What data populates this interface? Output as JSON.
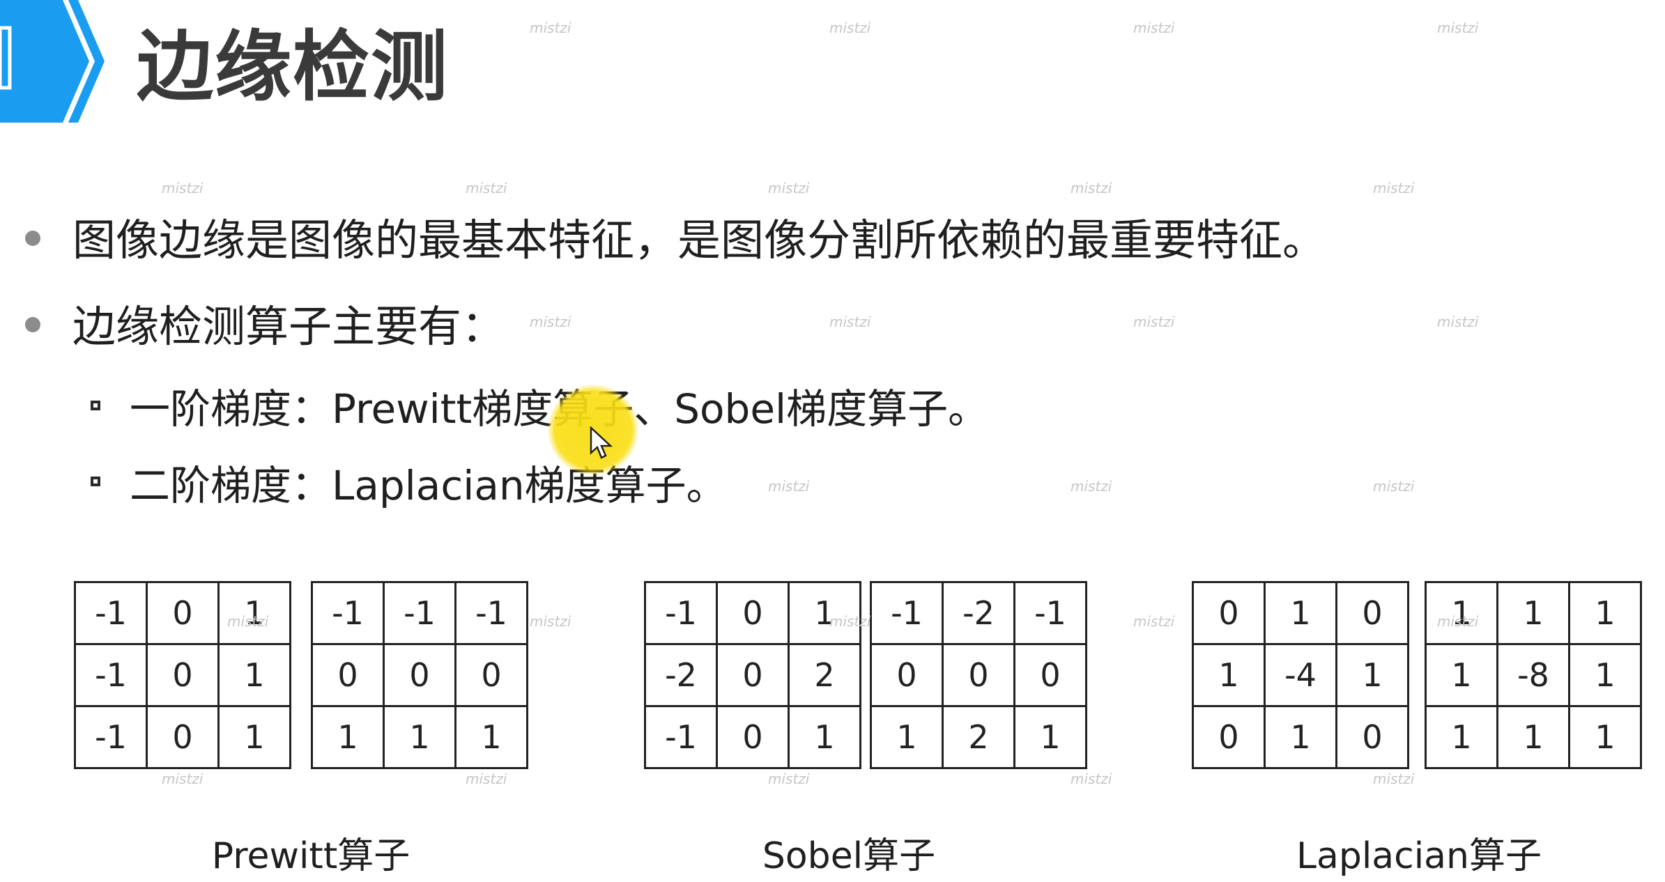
{
  "title": "边缘检测",
  "bullets": [
    "图像边缘是图像的最基本特征，是图像分割所依赖的最重要特征。",
    "边缘检测算子主要有："
  ],
  "sub_bullets": [
    "一阶梯度：Prewitt梯度算子、Sobel梯度算子。",
    "二阶梯度：Laplacian梯度算子。"
  ],
  "operators": [
    {
      "caption": "Prewitt算子",
      "kernels": [
        [
          [
            "-1",
            "0",
            "1"
          ],
          [
            "-1",
            "0",
            "1"
          ],
          [
            "-1",
            "0",
            "1"
          ]
        ],
        [
          [
            "-1",
            "-1",
            "-1"
          ],
          [
            "0",
            "0",
            "0"
          ],
          [
            "1",
            "1",
            "1"
          ]
        ]
      ]
    },
    {
      "caption": "Sobel算子",
      "kernels": [
        [
          [
            "-1",
            "0",
            "1"
          ],
          [
            "-2",
            "0",
            "2"
          ],
          [
            "-1",
            "0",
            "1"
          ]
        ],
        [
          [
            "-1",
            "-2",
            "-1"
          ],
          [
            "0",
            "0",
            "0"
          ],
          [
            "1",
            "2",
            "1"
          ]
        ]
      ]
    },
    {
      "caption": "Laplacian算子",
      "kernels": [
        [
          [
            "0",
            "1",
            "0"
          ],
          [
            "1",
            "-4",
            "1"
          ],
          [
            "0",
            "1",
            "0"
          ]
        ],
        [
          [
            "1",
            "1",
            "1"
          ],
          [
            "1",
            "-8",
            "1"
          ],
          [
            "1",
            "1",
            "1"
          ]
        ]
      ]
    }
  ],
  "watermark_text": "mistzi",
  "colors": {
    "header_tab": "#1a9df0",
    "cursor_highlight": "#fade14"
  }
}
